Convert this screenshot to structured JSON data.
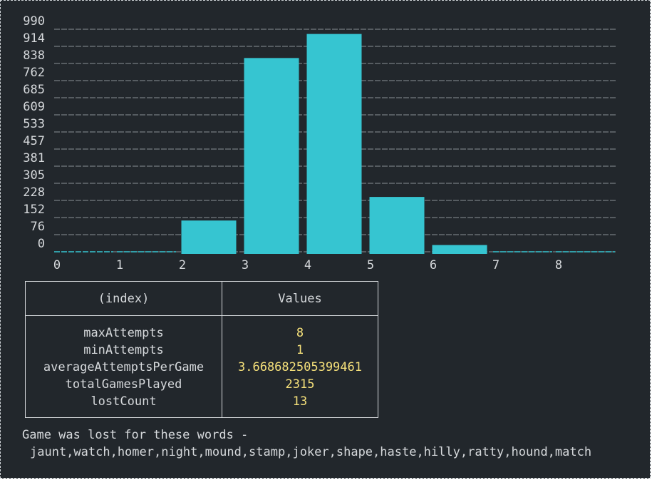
{
  "chart_data": {
    "type": "bar",
    "categories": [
      "0",
      "1",
      "2",
      "3",
      "4",
      "5",
      "6",
      "7",
      "8"
    ],
    "values": [
      0,
      1,
      139,
      862,
      969,
      244,
      30,
      1,
      0
    ],
    "y_ticks": [
      "0",
      "76",
      "152",
      "228",
      "305",
      "381",
      "457",
      "533",
      "609",
      "685",
      "762",
      "838",
      "914",
      "990"
    ],
    "ylim": [
      0,
      990
    ],
    "grid": true,
    "grid_style": "dashed",
    "bar_color": "#36c5d1",
    "title": "",
    "xlabel": "",
    "ylabel": ""
  },
  "table": {
    "headers": [
      "(index)",
      "Values"
    ],
    "rows": [
      {
        "key": "maxAttempts",
        "value": "8"
      },
      {
        "key": "minAttempts",
        "value": "1"
      },
      {
        "key": "averageAttemptsPerGame",
        "value": "3.668682505399461"
      },
      {
        "key": "totalGamesPlayed",
        "value": "2315"
      },
      {
        "key": "lostCount",
        "value": "13"
      }
    ]
  },
  "footer": {
    "title": "Game was lost for these words -",
    "words": "jaunt,watch,homer,night,mound,stamp,joker,shape,haste,hilly,ratty,hound,match"
  },
  "colors": {
    "background": "#22272c",
    "text": "#d6d9dc",
    "value_text": "#f5e07a",
    "accent": "#36c5d1"
  }
}
